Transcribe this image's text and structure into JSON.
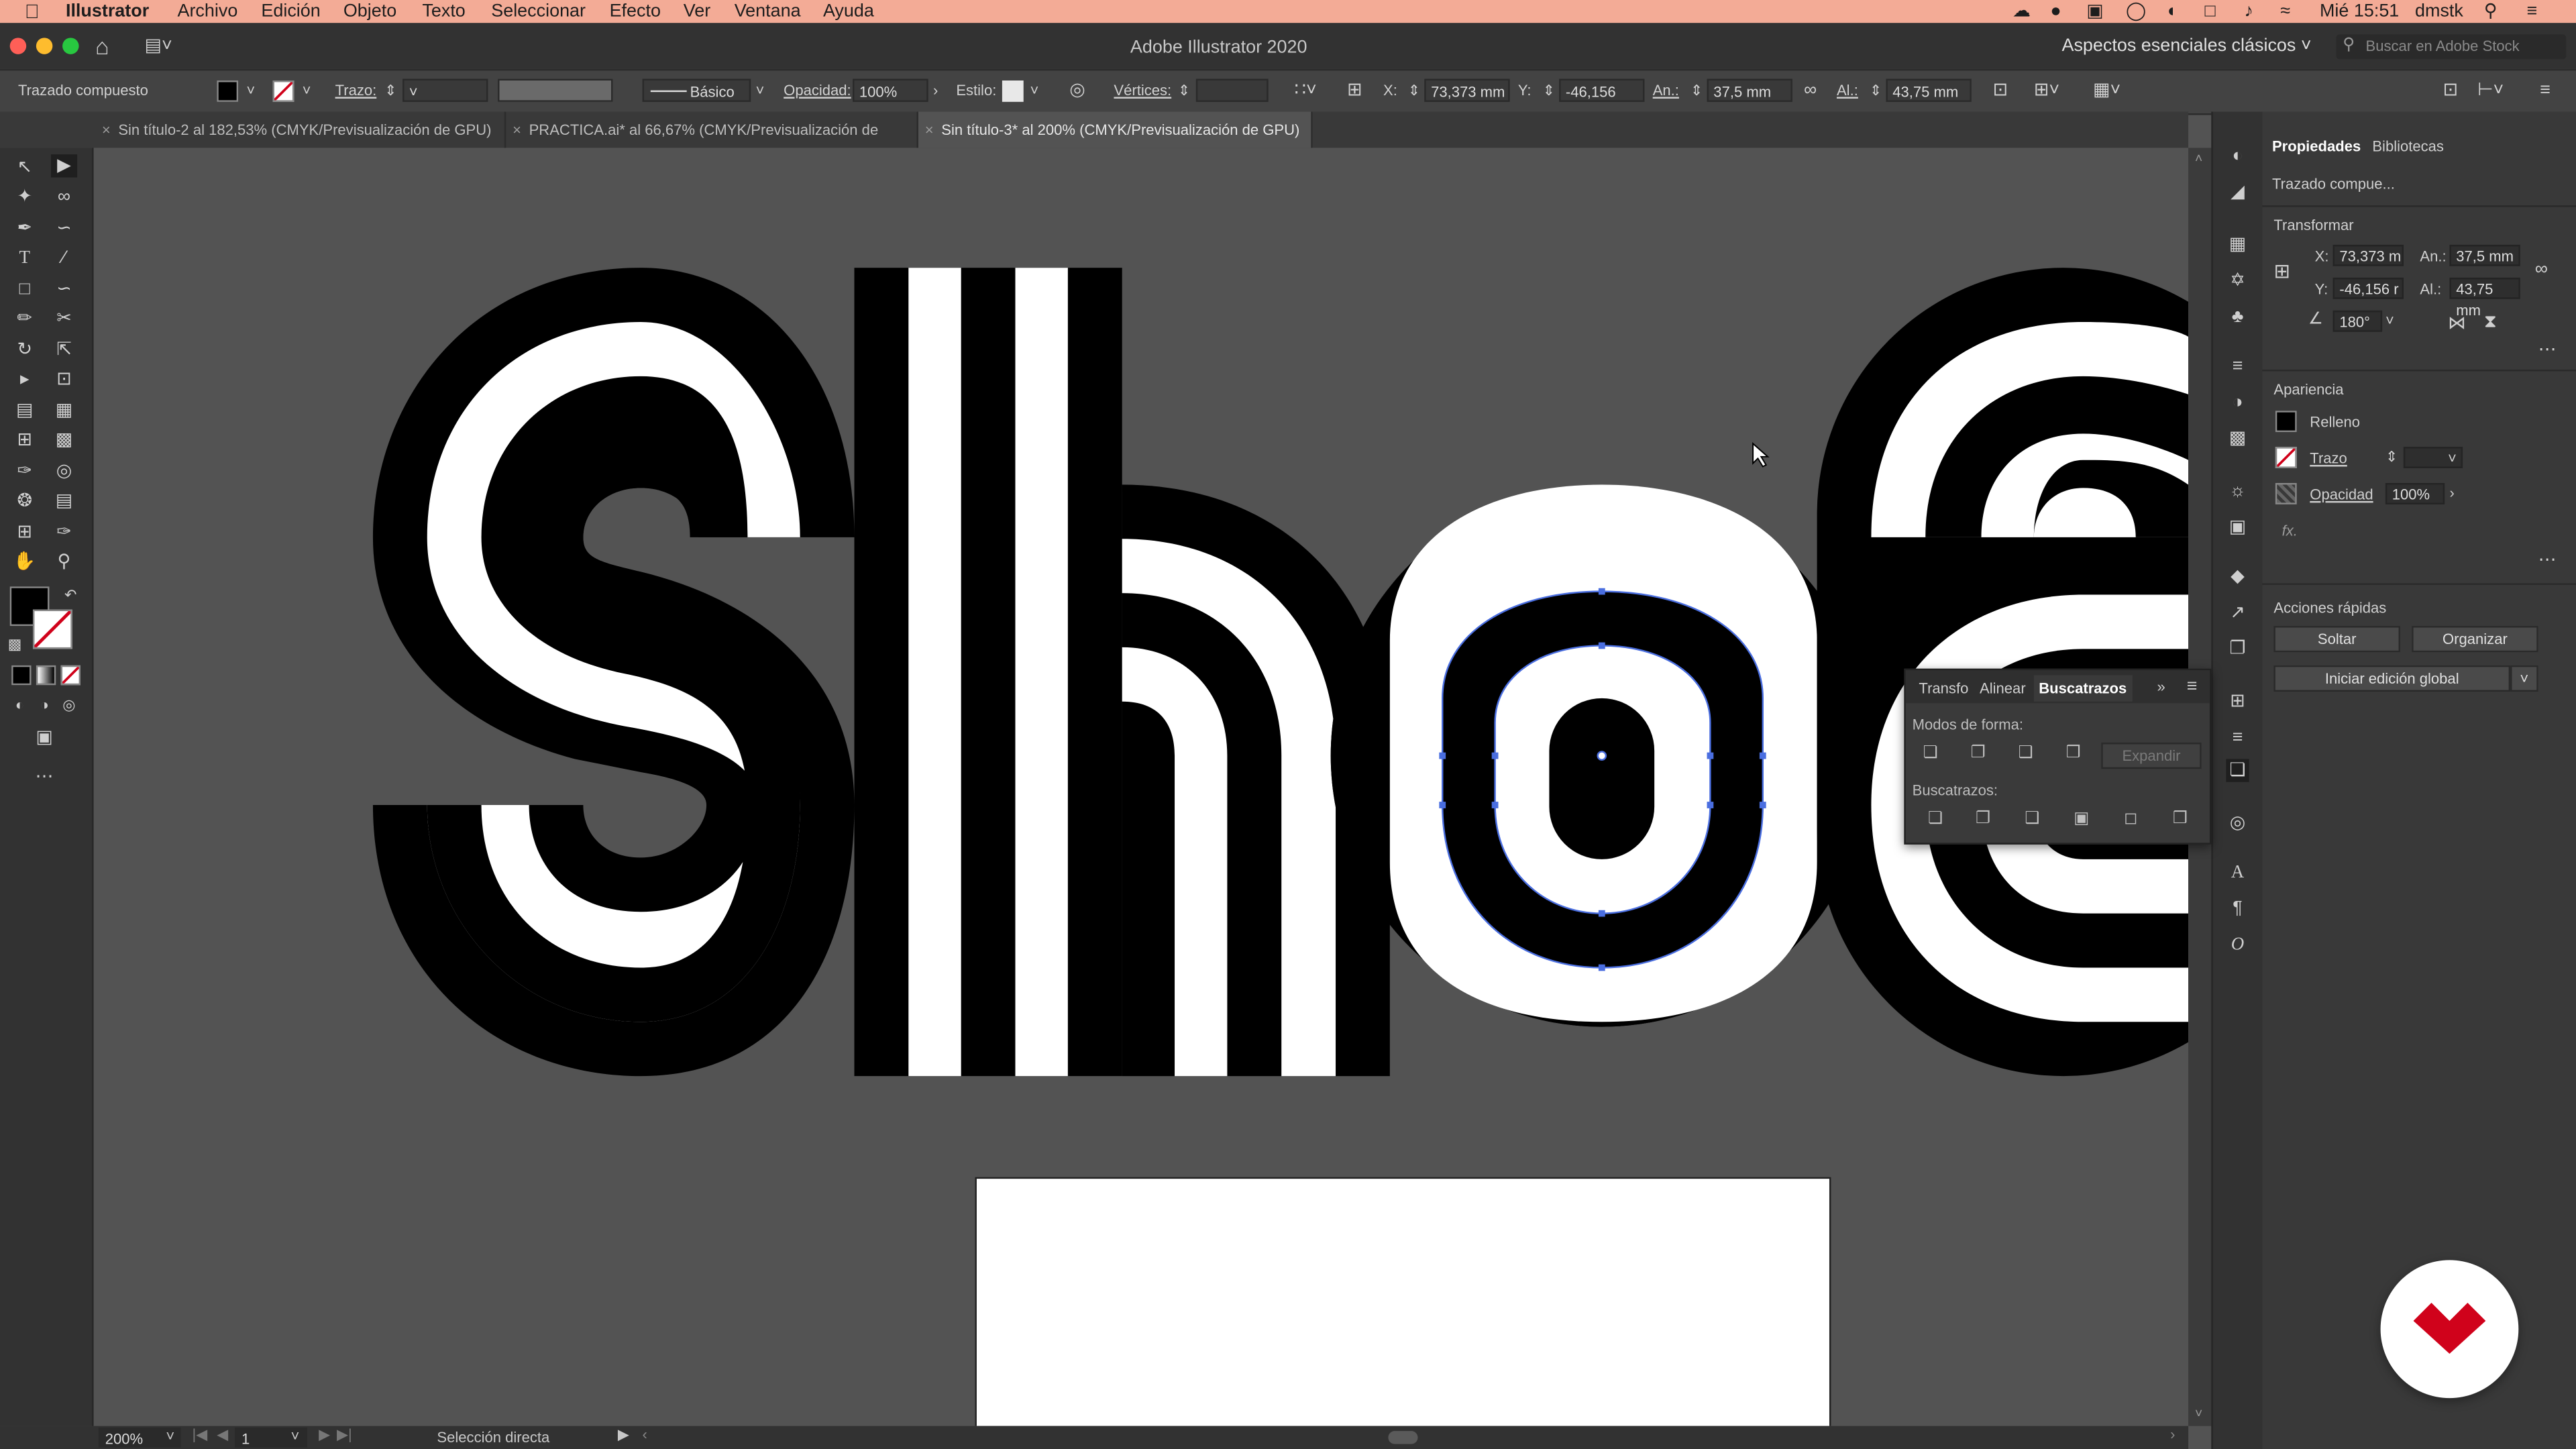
{
  "menubar": {
    "app": "Illustrator",
    "items": [
      "Archivo",
      "Edición",
      "Objeto",
      "Texto",
      "Seleccionar",
      "Efecto",
      "Ver",
      "Ventana",
      "Ayuda"
    ],
    "clock": "Mié 15:51",
    "user": "dmstk"
  },
  "titlebar": {
    "title": "Adobe Illustrator 2020",
    "workspace": "Aspectos esenciales clásicos",
    "search_placeholder": "Buscar en Adobe Stock"
  },
  "control": {
    "selection_type": "Trazado compuesto",
    "stroke_label": "Trazo:",
    "brush": "Básico",
    "opacity_label": "Opacidad:",
    "opacity": "100%",
    "style_label": "Estilo:",
    "vertices_label": "Vértices:",
    "x_label": "X:",
    "x": "73,373 mm",
    "y_label": "Y:",
    "y": "-46,156 mm",
    "w_label": "An.:",
    "w": "37,5 mm",
    "h_label": "Al.:",
    "h": "43,75 mm"
  },
  "tabs": [
    {
      "label": "Sin título-2 al 182,53% (CMYK/Previsualización de GPU)"
    },
    {
      "label": "PRACTICA.ai* al 66,67% (CMYK/Previsualización de GPU)"
    },
    {
      "label": "Sin título-3* al 200% (CMYK/Previsualización de GPU)"
    }
  ],
  "properties": {
    "tab_props": "Propiedades",
    "tab_libs": "Bibliotecas",
    "object_type": "Trazado compue...",
    "transform_title": "Transformar",
    "x_label": "X:",
    "x": "73,373 m",
    "y_label": "Y:",
    "y": "-46,156 r",
    "w_label": "An.:",
    "w": "37,5 mm",
    "h_label": "Al.:",
    "h": "43,75 mm",
    "angle": "180°",
    "appearance_title": "Apariencia",
    "fill_label": "Relleno",
    "stroke_label": "Trazo",
    "opacity_label": "Opacidad",
    "opacity": "100%",
    "fx": "fx.",
    "quick_actions_title": "Acciones rápidas",
    "release_btn": "Soltar",
    "arrange_btn": "Organizar",
    "global_edit_btn": "Iniciar edición global"
  },
  "pathfinder": {
    "tab_transform": "Transfo",
    "tab_align": "Alinear",
    "tab_pathfinder": "Buscatrazos",
    "shape_modes_label": "Modos de forma:",
    "expand_btn": "Expandir",
    "pathfinders_label": "Buscatrazos:"
  },
  "status": {
    "zoom": "200%",
    "artboard": "1",
    "tool": "Selección directa"
  },
  "colors": {
    "menubar": "#f3ab96",
    "logo_red": "#d0021b",
    "selection": "#4a6ee0"
  }
}
